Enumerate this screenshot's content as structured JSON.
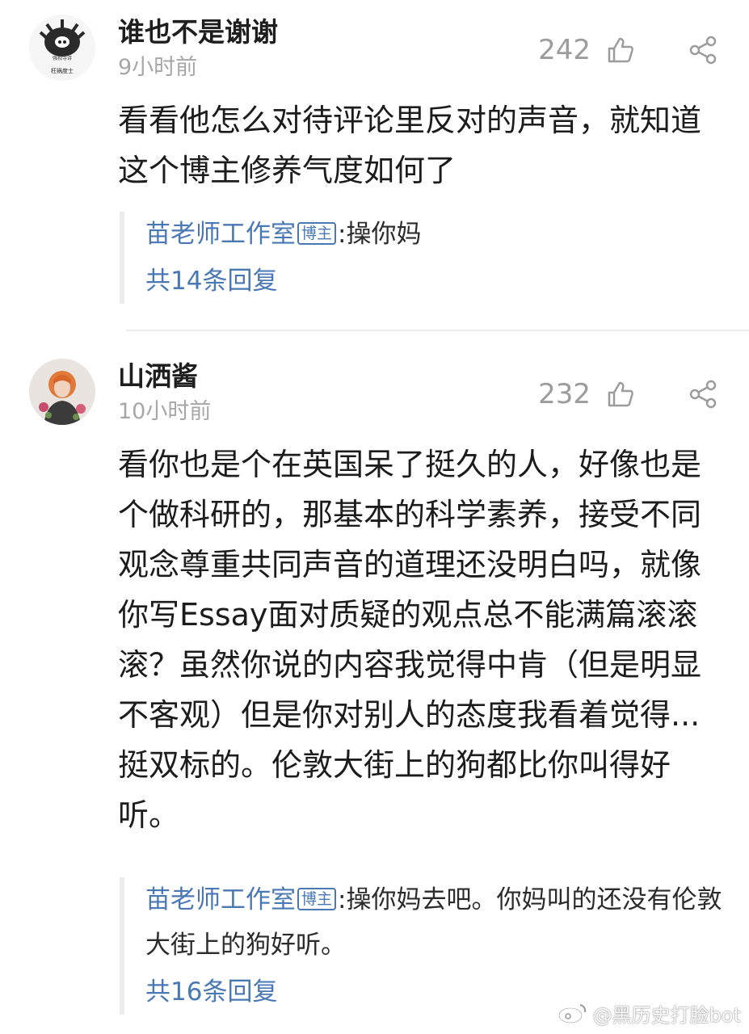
{
  "comments": [
    {
      "username": "谁也不是谢谢",
      "time": "9小时前",
      "likes": "242",
      "avatar_text": [
        "强视寺诗",
        "枉祸度士"
      ],
      "text": "看看他怎么对待评论里反对的声音，就知道这个博主修养气度如何了",
      "reply": {
        "author": "苗老师工作室",
        "badge": "博主",
        "content": ":操你妈",
        "count_label": "共14条回复"
      }
    },
    {
      "username": "山洒酱",
      "time": "10小时前",
      "likes": "232",
      "text": "看你也是个在英国呆了挺久的人，好像也是个做科研的，那基本的科学素养，接受不同观念尊重共同声音的道理还没明白吗，就像你写Essay面对质疑的观点总不能满篇滚滚滚？虽然你说的内容我觉得中肯（但是明显不客观）但是你对别人的态度我看着觉得...挺双标的。伦敦大街上的狗都比你叫得好听。",
      "reply": {
        "author": "苗老师工作室",
        "badge": "博主",
        "content": ":操你妈去吧。你妈叫的还没有伦敦大街上的狗好听。",
        "count_label": "共16条回复"
      }
    }
  ],
  "watermark": "@黑历史打脸bot",
  "icons": {
    "like": "thumbs-up-icon",
    "share": "share-icon",
    "watermark": "weibo-logo-icon"
  },
  "colors": {
    "link": "#4a78b4",
    "muted": "#a7a7a7"
  }
}
